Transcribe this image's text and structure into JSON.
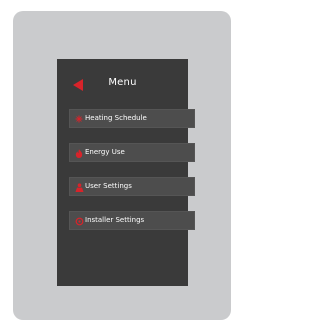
{
  "menu": {
    "title": "Menu",
    "items": [
      {
        "label": "Heating Schedule",
        "icon": "heating-schedule-icon"
      },
      {
        "label": "Energy Use",
        "icon": "flame-icon"
      },
      {
        "label": "User Settings",
        "icon": "user-icon"
      },
      {
        "label": "Installer Settings",
        "icon": "gear-icon"
      }
    ]
  },
  "colors": {
    "accent": "#d8232a",
    "screen_bg": "#3a3a3a",
    "item_bg": "#4d4d4d",
    "device_bg": "#cacbcd"
  }
}
